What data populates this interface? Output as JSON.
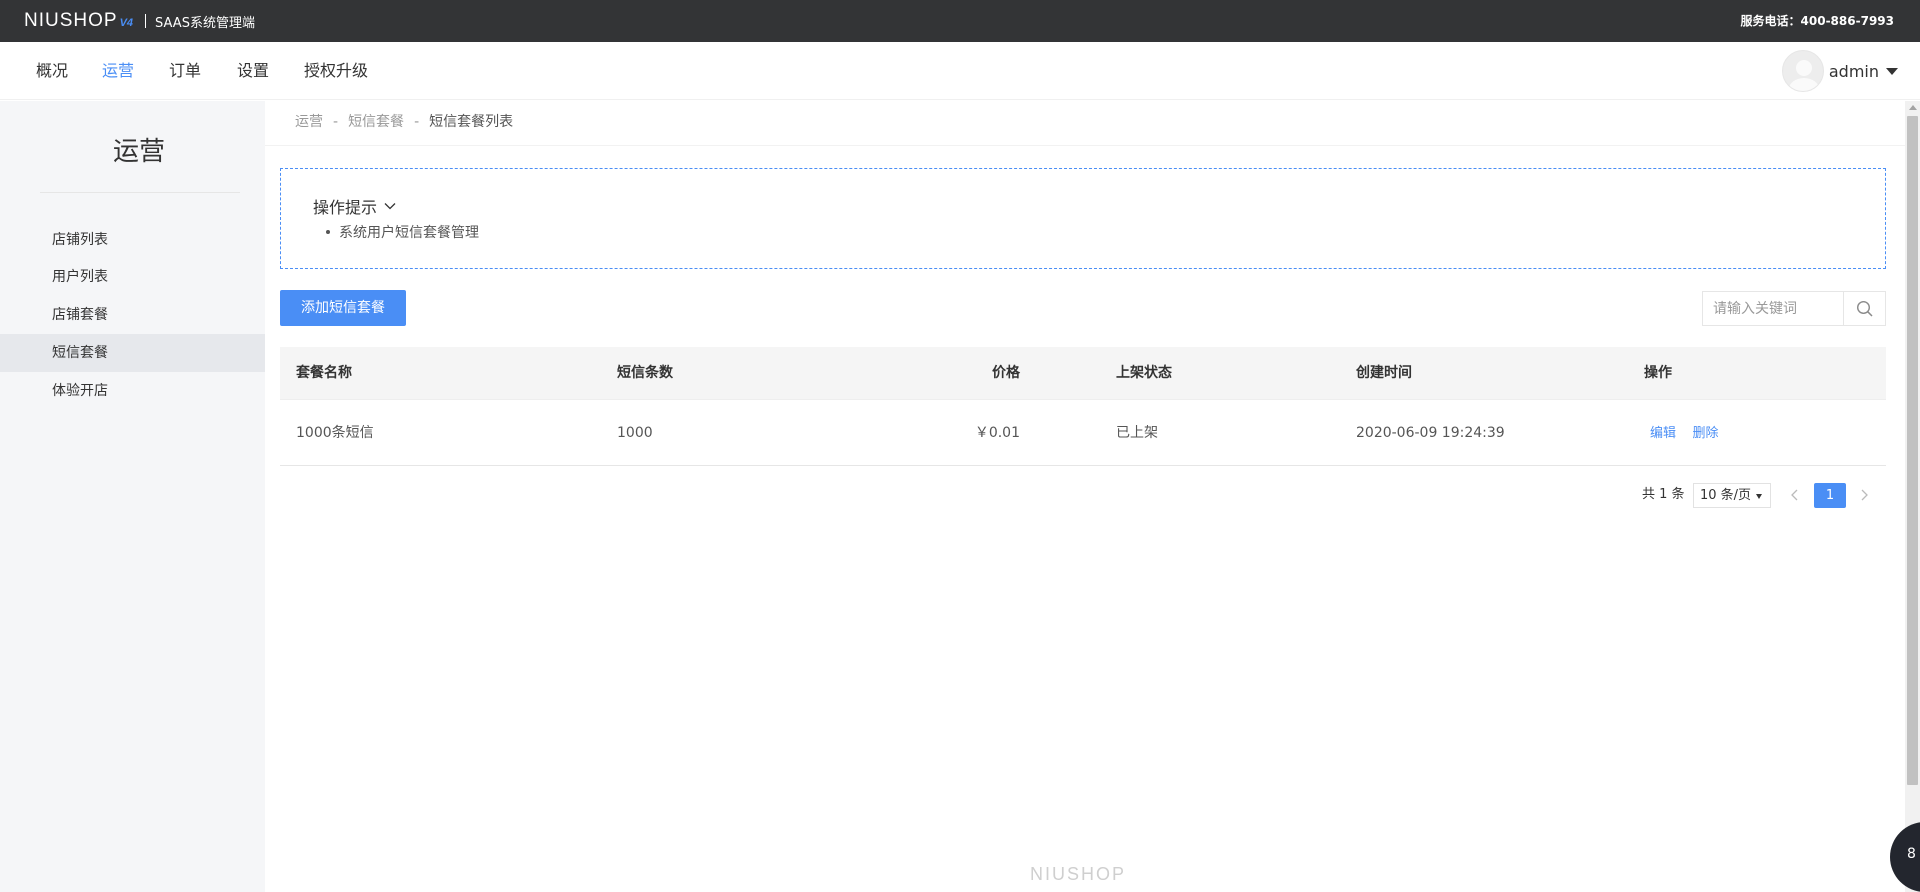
{
  "topbar": {
    "logo_text": "NIUSHOP",
    "logo_version": "V4",
    "subtitle": "SAAS系统管理端",
    "hotline": "服务电话：400-886-7993"
  },
  "nav": {
    "items": [
      {
        "label": "概况"
      },
      {
        "label": "运营",
        "active": true
      },
      {
        "label": "订单"
      },
      {
        "label": "设置"
      },
      {
        "label": "授权升级"
      }
    ],
    "user": "admin"
  },
  "sidebar": {
    "title": "运营",
    "items": [
      {
        "label": "店铺列表"
      },
      {
        "label": "用户列表"
      },
      {
        "label": "店铺套餐"
      },
      {
        "label": "短信套餐",
        "active": true
      },
      {
        "label": "体验开店"
      }
    ]
  },
  "breadcrumb": {
    "items": [
      "运营",
      "短信套餐",
      "短信套餐列表"
    ],
    "separator": "-"
  },
  "tips": {
    "title": "操作提示",
    "items": [
      "系统用户短信套餐管理"
    ]
  },
  "toolbar": {
    "add_label": "添加短信套餐",
    "search_placeholder": "请输入关键词"
  },
  "table": {
    "headers": [
      "套餐名称",
      "短信条数",
      "价格",
      "上架状态",
      "创建时间",
      "操作"
    ],
    "rows": [
      {
        "name": "1000条短信",
        "count": "1000",
        "price": "￥0.01",
        "status": "已上架",
        "created": "2020-06-09 19:24:39",
        "edit": "编辑",
        "delete": "删除"
      }
    ]
  },
  "pagination": {
    "total": "共 1 条",
    "page_size": "10 条/页",
    "current_page": "1"
  },
  "footer": {
    "logo_text": "NIUSHOP"
  },
  "float_button": {
    "label": "8"
  },
  "colors": {
    "accent": "#4a8ef5",
    "topbar": "#333436",
    "sidebar": "#f5f6f8"
  }
}
